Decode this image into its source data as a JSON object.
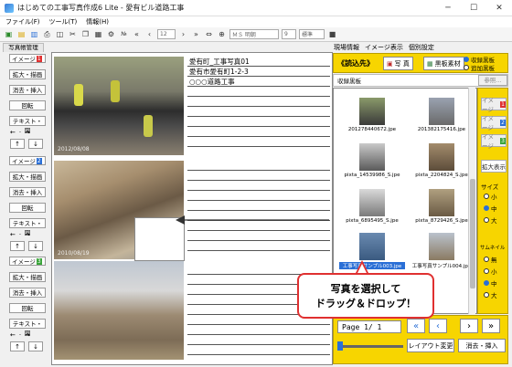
{
  "window": {
    "title": "はじめての工事写真作成6 Lite - 愛有ビル道路工事"
  },
  "menu": [
    "ファイル(F)",
    "ツール(T)",
    "情報(H)"
  ],
  "toolbar": {
    "page_num": "12",
    "font_size": "9",
    "font_name": "ＭＳ 明朝",
    "style": "標準"
  },
  "left_tab": "写真帳管理",
  "image_groups": [
    {
      "label": "イメージ",
      "num": "1",
      "buttons": [
        "拡大・描画",
        "消去・挿入",
        "回転",
        "テキスト・図"
      ]
    },
    {
      "label": "イメージ",
      "num": "2",
      "buttons": [
        "拡大・描画",
        "消去・挿入",
        "回転",
        "テキスト・図"
      ]
    },
    {
      "label": "イメージ",
      "num": "3",
      "buttons": [
        "拡大・描画",
        "消去・挿入",
        "回転",
        "テキスト・図"
      ]
    }
  ],
  "doc": {
    "line1": "愛有町_工事写真01",
    "line2": "愛有市愛有町1-2-3",
    "line3": "○○○道路工事",
    "photo1_date": "2012/08/08",
    "photo2_date": "2010/08/19"
  },
  "right_tabs": [
    "現場情報",
    "イメージ表示",
    "個別設定"
  ],
  "right_panel": {
    "yomikomi": "《読込先》",
    "photo_btn": "写 真",
    "blackboard_btn": "黒板素材",
    "radio1": "収録黒板",
    "radio2": "追加黒板",
    "folder_label": "収録黒板",
    "ref_btn": "参照..."
  },
  "thumbs": [
    {
      "caption": "201278440672.jpe"
    },
    {
      "caption": "201382175416.jpe"
    },
    {
      "caption": "pixta_14539986_S.jpe"
    },
    {
      "caption": "pixta_2204824_S.jpe"
    },
    {
      "caption": "pixta_6895495_S.jpe"
    },
    {
      "caption": "pixta_8729426_S.jpe"
    },
    {
      "caption": "工事写真サンプル003.jpe"
    },
    {
      "caption": "工事写真サンプル004.jpe"
    }
  ],
  "side_buttons": {
    "img1": "イメージ",
    "n1": "1",
    "img2": "イメージ",
    "n2": "2",
    "img3": "イメージ",
    "n3": "3",
    "expand": "拡大表示",
    "size_label": "サイズ",
    "size_small": "小",
    "size_mid": "中",
    "size_large": "大",
    "thumb_label": "サムネイル",
    "t_none": "無",
    "t_small": "小",
    "t_mid": "中",
    "t_large": "大"
  },
  "footer": {
    "page_text": "Page 1/ 1",
    "layout_btn": "レイアウト変更",
    "erase_btn": "消去・挿入"
  },
  "callout": {
    "line1": "写真を選択して",
    "line2": "ドラッグ＆ドロップ！"
  }
}
